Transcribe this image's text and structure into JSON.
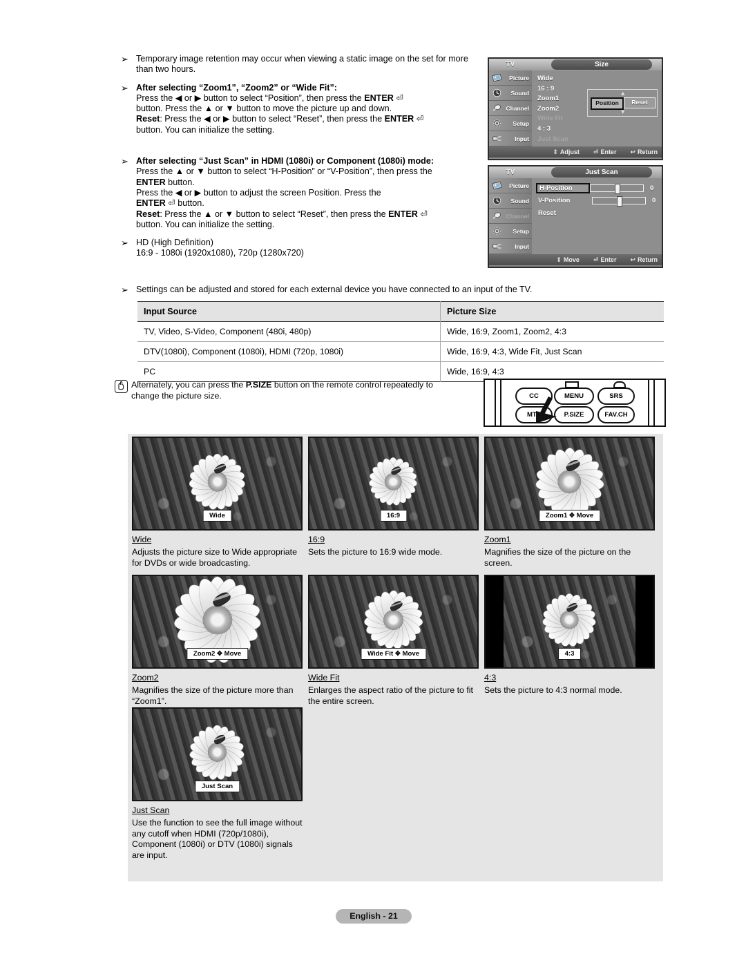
{
  "notes": [
    {
      "marker": "➢",
      "lines": [
        {
          "parts": [
            {
              "t": "Temporary image retention may occur when viewing a static image on the set for more than two hours.",
              "b": false
            }
          ]
        }
      ]
    },
    {
      "marker": "➢",
      "lines": [
        {
          "parts": [
            {
              "t": "After selecting “Zoom1”, “Zoom2” or “Wide Fit”:",
              "b": true
            }
          ]
        },
        {
          "parts": [
            {
              "t": "Press the ◀ or ▶ button to select “Position”, then press the ",
              "b": false
            },
            {
              "t": "ENTER",
              "b": true
            },
            {
              "t": " ⏎",
              "b": false
            }
          ]
        },
        {
          "parts": [
            {
              "t": "button. Press the ▲ or ▼ button to move the picture up and down.",
              "b": false
            }
          ]
        },
        {
          "parts": [
            {
              "t": "Reset",
              "b": true
            },
            {
              "t": ": Press the ◀ or ▶ button to select “Reset”, then press the ",
              "b": false
            },
            {
              "t": "ENTER",
              "b": true
            },
            {
              "t": " ⏎",
              "b": false
            }
          ]
        },
        {
          "parts": [
            {
              "t": "button. You can initialize the setting.",
              "b": false
            }
          ]
        }
      ]
    },
    {
      "marker": "➢",
      "lines": [
        {
          "parts": [
            {
              "t": "After selecting “Just Scan” in HDMI (1080i) or Component (1080i) mode:",
              "b": true
            }
          ]
        },
        {
          "parts": [
            {
              "t": "Press the ▲ or ▼ button to select “H-Position” or “V-Position”, then press the",
              "b": false
            }
          ]
        },
        {
          "parts": [
            {
              "t": "ENTER",
              "b": true
            },
            {
              "t": " button.",
              "b": false
            }
          ]
        },
        {
          "parts": [
            {
              "t": "Press the ◀ or ▶ button to adjust the screen Position. Press the",
              "b": false
            }
          ]
        },
        {
          "parts": [
            {
              "t": "ENTER",
              "b": true
            },
            {
              "t": " ⏎ button.",
              "b": false
            }
          ]
        },
        {
          "parts": [
            {
              "t": "Reset",
              "b": true
            },
            {
              "t": ": Press the ▲ or ▼ button to select “Reset”, then press the ",
              "b": false
            },
            {
              "t": "ENTER",
              "b": true
            },
            {
              "t": " ⏎",
              "b": false
            }
          ]
        },
        {
          "parts": [
            {
              "t": "button. You can initialize the setting.",
              "b": false
            }
          ]
        }
      ]
    },
    {
      "marker": "➢",
      "lines": [
        {
          "parts": [
            {
              "t": "HD (High Definition)",
              "b": false
            }
          ]
        },
        {
          "parts": [
            {
              "t": "16:9 - 1080i (1920x1080), 720p (1280x720)",
              "b": false
            }
          ]
        }
      ]
    }
  ],
  "settings_note": {
    "marker": "➢",
    "text": "Settings can be adjusted and stored for each external device you have connected to an input of the TV."
  },
  "osd_size": {
    "tv_label": "TV",
    "title": "Size",
    "sidebar": [
      {
        "label": "Picture",
        "icon": "picture-icon",
        "dim": false
      },
      {
        "label": "Sound",
        "icon": "sound-icon",
        "dim": false
      },
      {
        "label": "Channel",
        "icon": "channel-icon",
        "dim": false
      },
      {
        "label": "Setup",
        "icon": "setup-icon",
        "dim": false
      },
      {
        "label": "Input",
        "icon": "input-icon",
        "dim": false
      }
    ],
    "options": [
      {
        "label": "Wide",
        "dim": false
      },
      {
        "label": "16 : 9",
        "dim": false
      },
      {
        "label": "Zoom1",
        "dim": false
      },
      {
        "label": "Zoom2",
        "dim": false
      },
      {
        "label": "Wide Fit",
        "dim": true
      },
      {
        "label": "4 : 3",
        "dim": false
      },
      {
        "label": "Just Scan",
        "dim": true
      }
    ],
    "position_button": "Position",
    "reset_button": "Reset",
    "footer": [
      {
        "icon": "updown-arrow-icon",
        "label": "Adjust"
      },
      {
        "icon": "enter-icon",
        "label": "Enter"
      },
      {
        "icon": "return-icon",
        "label": "Return"
      }
    ]
  },
  "osd_justscan": {
    "tv_label": "TV",
    "title": "Just Scan",
    "sidebar": [
      {
        "label": "Picture",
        "icon": "picture-icon",
        "dim": false
      },
      {
        "label": "Sound",
        "icon": "sound-icon",
        "dim": false
      },
      {
        "label": "Channel",
        "icon": "channel-icon",
        "dim": true
      },
      {
        "label": "Setup",
        "icon": "setup-icon",
        "dim": false
      },
      {
        "label": "Input",
        "icon": "input-icon",
        "dim": false
      }
    ],
    "rows": [
      {
        "label": "H-Position",
        "value": "0",
        "selected": true,
        "slider": true
      },
      {
        "label": "V-Position",
        "value": "0",
        "selected": false,
        "slider": true
      },
      {
        "label": "Reset",
        "value": "",
        "selected": false,
        "slider": false
      }
    ],
    "footer": [
      {
        "icon": "updown-arrow-icon",
        "label": "Move"
      },
      {
        "icon": "enter-icon",
        "label": "Enter"
      },
      {
        "icon": "return-icon",
        "label": "Return"
      }
    ]
  },
  "table": {
    "headers": [
      "Input Source",
      "Picture Size"
    ],
    "rows": [
      [
        "TV, Video, S-Video, Component (480i, 480p)",
        "Wide, 16:9, Zoom1, Zoom2, 4:3"
      ],
      [
        "DTV(1080i), Component (1080i), HDMI (720p, 1080i)",
        "Wide, 16:9, 4:3, Wide Fit, Just Scan"
      ],
      [
        "PC",
        "Wide, 16:9, 4:3"
      ]
    ]
  },
  "alternately": {
    "icon": "hand-pointer-icon",
    "line1_pre": "Alternately, you can press the ",
    "bold": "P.SIZE",
    "line1_post": " button on the remote control repeatedly to",
    "line2": "change the picture size."
  },
  "remote": {
    "keys_top": [
      "CC",
      "MENU",
      "SRS"
    ],
    "keys_bottom": [
      "MTS",
      "P.SIZE",
      "FAV.CH"
    ],
    "pointer_icon": "hand-pointing-icon"
  },
  "picture_modes": [
    {
      "overlay": "Wide",
      "title": "Wide",
      "desc": "Adjusts the picture size to Wide appropriate for DVDs or wide broadcasting.",
      "pillarbox": false,
      "flower_scale": 1.0
    },
    {
      "overlay": "16:9",
      "title": "16:9",
      "desc": "Sets the picture to 16:9 wide mode.",
      "pillarbox": false,
      "flower_scale": 0.86
    },
    {
      "overlay": "Zoom1 ✥ Move",
      "title": "Zoom1",
      "desc": "Magnifies the size of the picture on the screen.",
      "pillarbox": false,
      "flower_scale": 1.22
    },
    {
      "overlay": "Zoom2 ✥ Move",
      "title": "Zoom2",
      "desc": "Magnifies the size of the picture more than “Zoom1”.",
      "pillarbox": false,
      "flower_scale": 1.55
    },
    {
      "overlay": "Wide Fit ✥ Move",
      "title": "Wide Fit",
      "desc": "Enlarges the aspect ratio of the picture to fit the entire screen.",
      "pillarbox": false,
      "flower_scale": 1.05
    },
    {
      "overlay": "4:3",
      "title": "4:3",
      "desc": "Sets the picture to 4:3 normal mode.",
      "pillarbox": true,
      "flower_scale": 0.95
    },
    {
      "overlay": "Just Scan",
      "title": "Just Scan",
      "desc": "Use the function to see the full image without any cutoff when HDMI (720p/1080i), Component (1080i) or DTV (1080i) signals are input.",
      "pillarbox": false,
      "flower_scale": 0.98
    }
  ],
  "footer": {
    "label": "English - 21"
  }
}
